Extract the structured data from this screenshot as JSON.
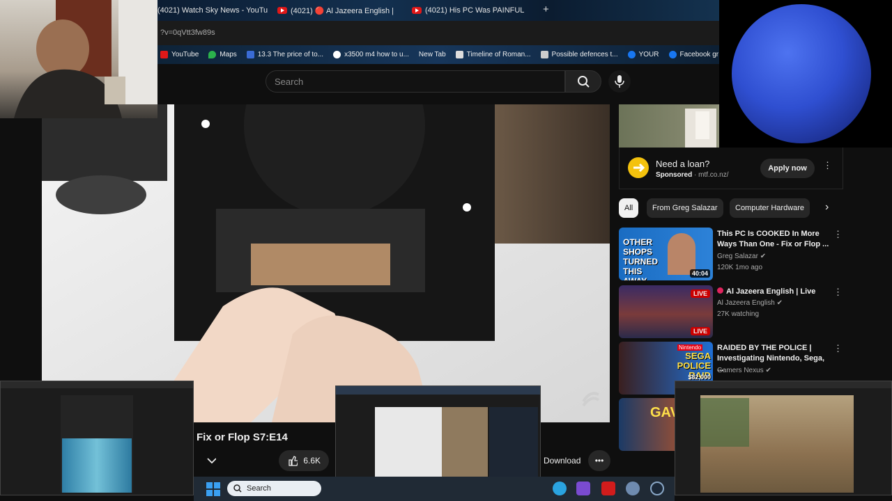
{
  "tabs": [
    {
      "label": "(4021) Watch Sky News - YouTu",
      "close": "×"
    },
    {
      "label": "(4021) 🔴 Al Jazeera English |",
      "close": "×"
    },
    {
      "label": "(4021) His PC Was PAINFUL",
      "close": "×"
    }
  ],
  "new_tab": "+",
  "url": "?v=0qVtt3fw89s",
  "bookmarks": [
    {
      "label": "YouTube",
      "color": "#e01818"
    },
    {
      "label": "Maps",
      "color": "#2bb24c"
    },
    {
      "label": "13.3 The price of to...",
      "color": "#3a6bd4"
    },
    {
      "label": "x3500 m4 how to u...",
      "color": "#ffffff"
    },
    {
      "label": "New Tab",
      "color": "#888888"
    },
    {
      "label": "Timeline of Roman...",
      "color": "#dddddd"
    },
    {
      "label": "Possible defences t...",
      "color": "#cccccc"
    },
    {
      "label": "YOUR",
      "color": "#1877f2"
    },
    {
      "label": "Facebook gr",
      "color": "#1877f2"
    }
  ],
  "search": {
    "placeholder": "Search"
  },
  "video": {
    "title": "Fix or Flop S7:E14"
  },
  "actions": {
    "likes": "6.6K",
    "download": "Download",
    "more": "•••"
  },
  "ad": {
    "title": "Need a loan?",
    "sponsored": "Sponsored",
    "domain": "mtf.co.nz/",
    "cta": "Apply now"
  },
  "chips": [
    "All",
    "From Greg Salazar",
    "Computer Hardware"
  ],
  "recommendations": [
    {
      "title": "This PC Is COOKED In More Ways Than One - Fix or Flop ...",
      "channel": "Greg Salazar",
      "meta": "120K  1mo ago",
      "duration": "40:04",
      "thumb_text": "OTHER SHOPS TURNED THIS AWAY"
    },
    {
      "title": "Al Jazeera English | Live",
      "channel": "Al Jazeera English",
      "meta": "27K watching",
      "badge": "LIVE",
      "badge2": "LIVE"
    },
    {
      "title": "RAIDED BY THE POLICE | Investigating Nintendo, Sega, ...",
      "channel": "Gamers Nexus",
      "thumb_text": "SEGA POLICE RAID",
      "thumb_sub": "$82,000 DEVKITS",
      "thumb_top": "Nintendo"
    },
    {
      "thumb_text": "GAV"
    }
  ],
  "taskbar": {
    "search": "Search"
  },
  "colors": {
    "accent": "#ff0000",
    "bg": "#0f0f0f",
    "chip_active": "#f1f1f1"
  }
}
